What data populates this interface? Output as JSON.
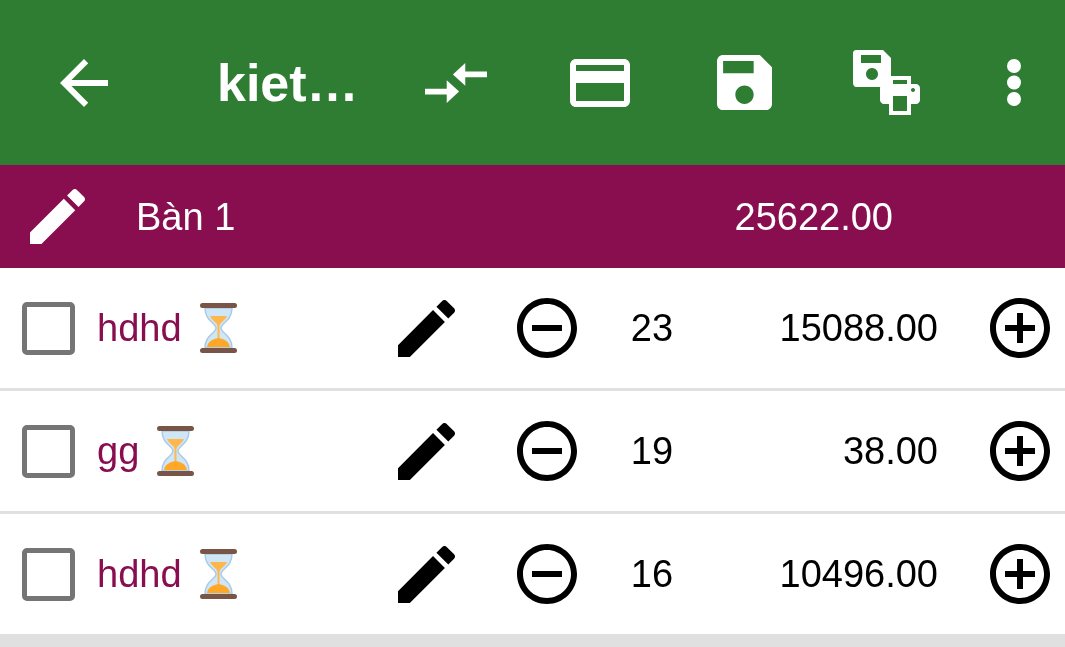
{
  "toolbar": {
    "title": "kiet…"
  },
  "table_header": {
    "name": "Bàn 1",
    "total": "25622.00"
  },
  "rows": [
    {
      "checked": false,
      "name": "hdhd",
      "quantity": "23",
      "amount": "15088.00"
    },
    {
      "checked": false,
      "name": "gg",
      "quantity": "19",
      "amount": "38.00"
    },
    {
      "checked": false,
      "name": "hdhd",
      "quantity": "16",
      "amount": "10496.00"
    }
  ]
}
